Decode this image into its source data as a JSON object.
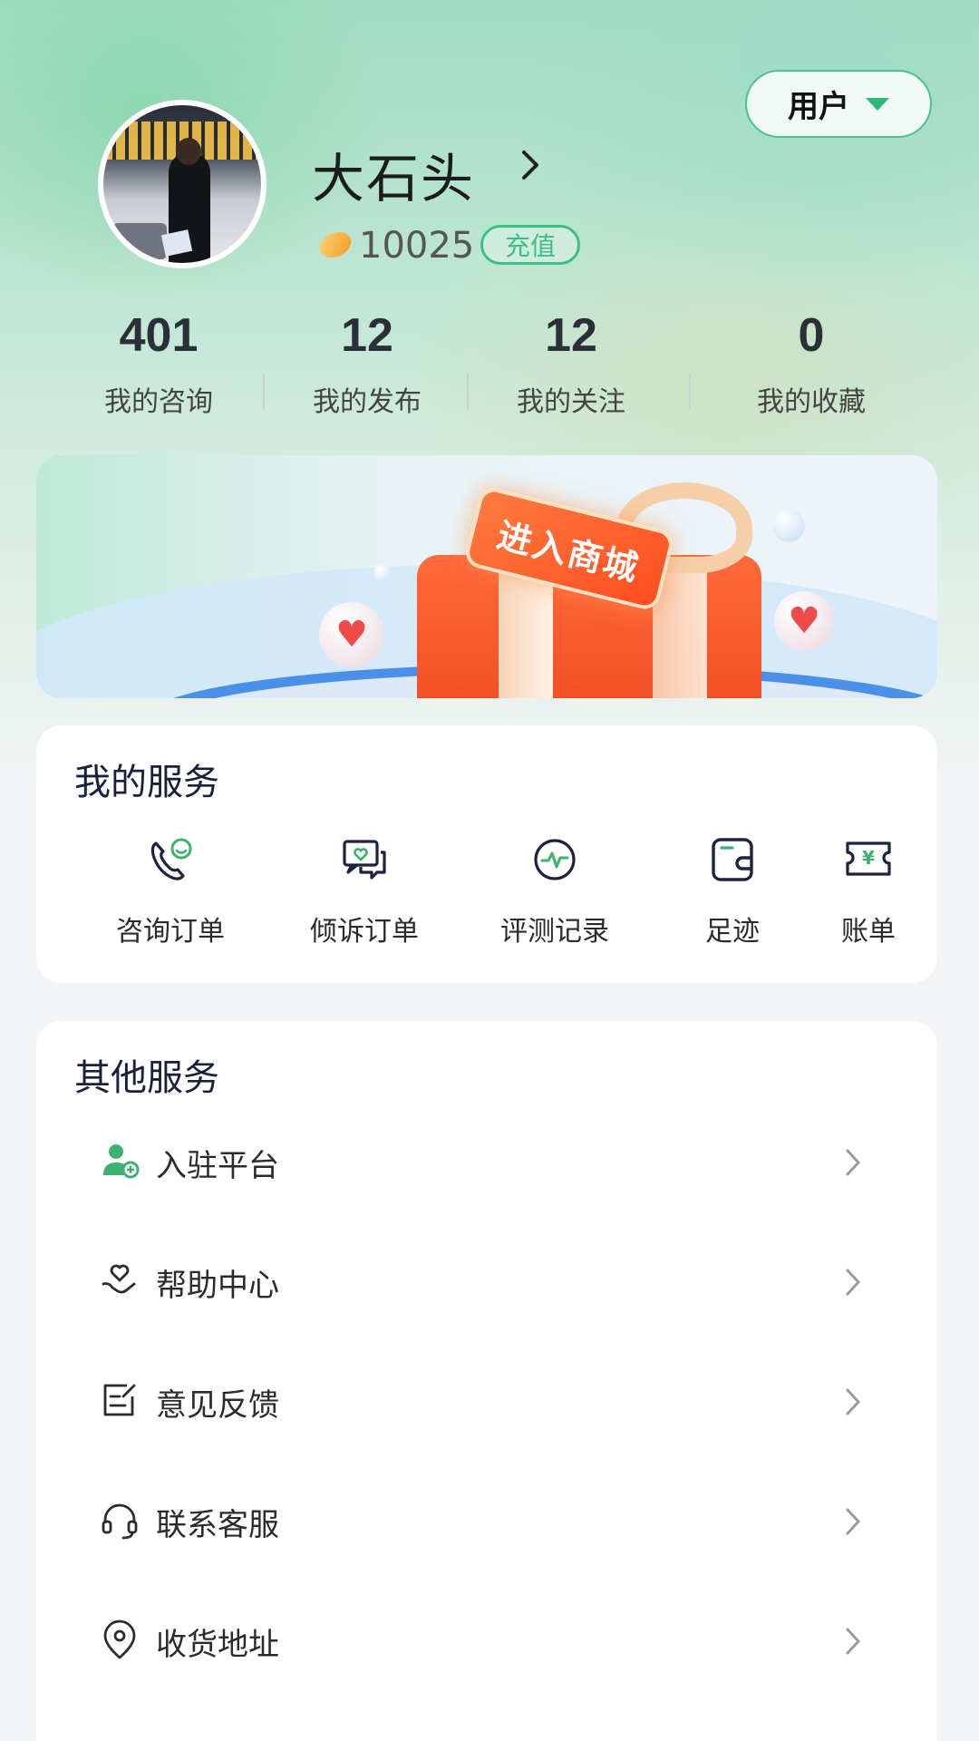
{
  "profile": {
    "name": "大石头",
    "coins": "10025",
    "recharge_label": "充值",
    "role_label": "用户"
  },
  "stats": [
    {
      "value": "401",
      "label": "我的咨询"
    },
    {
      "value": "12",
      "label": "我的发布"
    },
    {
      "value": "12",
      "label": "我的关注"
    },
    {
      "value": "0",
      "label": "我的收藏"
    }
  ],
  "banner": {
    "label": "进入商城"
  },
  "my_services": {
    "title": "我的服务",
    "items": [
      {
        "label": "咨询订单",
        "icon": "phone-smile-icon"
      },
      {
        "label": "倾诉订单",
        "icon": "chat-heart-icon"
      },
      {
        "label": "评测记录",
        "icon": "pulse-icon"
      },
      {
        "label": "足迹",
        "icon": "footprint-icon"
      },
      {
        "label": "账单",
        "icon": "bill-icon"
      }
    ]
  },
  "other_services": {
    "title": "其他服务",
    "items": [
      {
        "label": "入驻平台",
        "icon": "user-add-icon"
      },
      {
        "label": "帮助中心",
        "icon": "heart-hand-icon"
      },
      {
        "label": "意见反馈",
        "icon": "feedback-icon"
      },
      {
        "label": "联系客服",
        "icon": "headset-icon"
      },
      {
        "label": "收货地址",
        "icon": "location-icon"
      }
    ]
  },
  "colors": {
    "accent_green": "#3cbf86",
    "title_navy": "#1b1f3b"
  }
}
